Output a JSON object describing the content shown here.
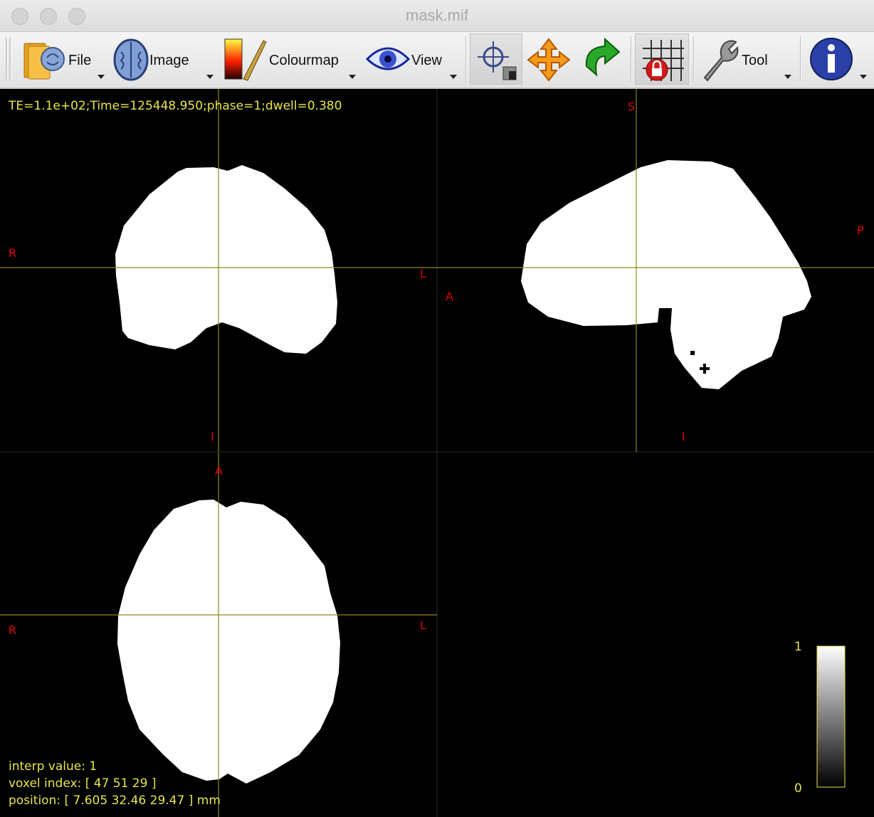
{
  "window": {
    "title": "mask.mif"
  },
  "toolbar": {
    "file_label": "File",
    "image_label": "Image",
    "colourmap_label": "Colourmap",
    "view_label": "View",
    "tool_label": "Tool"
  },
  "overlay": {
    "header_info": "TE=1.1e+02;Time=125448.950;phase=1;dwell=0.380",
    "interp_value": "interp value: 1",
    "voxel_index": "voxel index: [ 47 51 29 ]",
    "position": "position: [ 7.605 32.46 29.47 ] mm"
  },
  "orientation": {
    "coronal": {
      "left": "R",
      "right": "L",
      "bottom": "I"
    },
    "sagittal": {
      "top": "S",
      "left": "A",
      "right": "P",
      "bottom": "I"
    },
    "axial": {
      "top": "A",
      "left": "R",
      "right": "L"
    }
  },
  "colourbar": {
    "max": "1",
    "min": "0"
  },
  "colors": {
    "overlay_text": "#e6e64a",
    "orientation_text": "#e00000",
    "crosshair": "#8a8a1e",
    "mask": "#ffffff",
    "background": "#000000"
  }
}
